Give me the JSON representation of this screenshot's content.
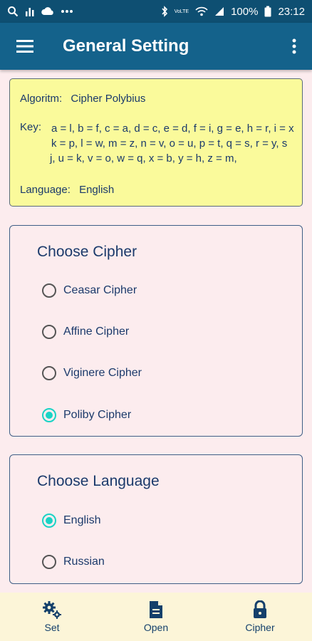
{
  "status_bar": {
    "battery": "100%",
    "time": "23:12",
    "network_label": "VoLTE"
  },
  "toolbar": {
    "title": "General Setting"
  },
  "info": {
    "algorithm_label": "Algoritm:",
    "algorithm_value": "Cipher Polybius",
    "key_label": "Key:",
    "key_lines": [
      "a = l, b = f, c = a, d = c, e = d, f = i, g = e, h = r, i = x",
      "k = p, l = w, m = z, n = v, o = u, p = t, q = s, r = y, s",
      "j, u = k, v = o, w = q, x = b, y = h, z = m,"
    ],
    "language_label": "Language:",
    "language_value": "English"
  },
  "cipher_card": {
    "title": "Choose Cipher",
    "options": [
      {
        "label": "Ceasar Cipher",
        "selected": false
      },
      {
        "label": "Affine Cipher",
        "selected": false
      },
      {
        "label": "Viginere Cipher",
        "selected": false
      },
      {
        "label": "Poliby Cipher",
        "selected": true
      }
    ]
  },
  "language_card": {
    "title": "Choose Language",
    "options": [
      {
        "label": "English",
        "selected": true
      },
      {
        "label": "Russian",
        "selected": false
      }
    ]
  },
  "bottom_nav": {
    "items": [
      {
        "label": "Set",
        "icon": "gears-icon"
      },
      {
        "label": "Open",
        "icon": "document-icon"
      },
      {
        "label": "Cipher",
        "icon": "lock-icon"
      }
    ]
  },
  "colors": {
    "status_bar": "#0e4f72",
    "toolbar": "#14628b",
    "info_card": "#fafa9b",
    "background": "#fcecee",
    "radio_selected": "#19d3c5",
    "bottom_nav": "#fcf5d8"
  }
}
